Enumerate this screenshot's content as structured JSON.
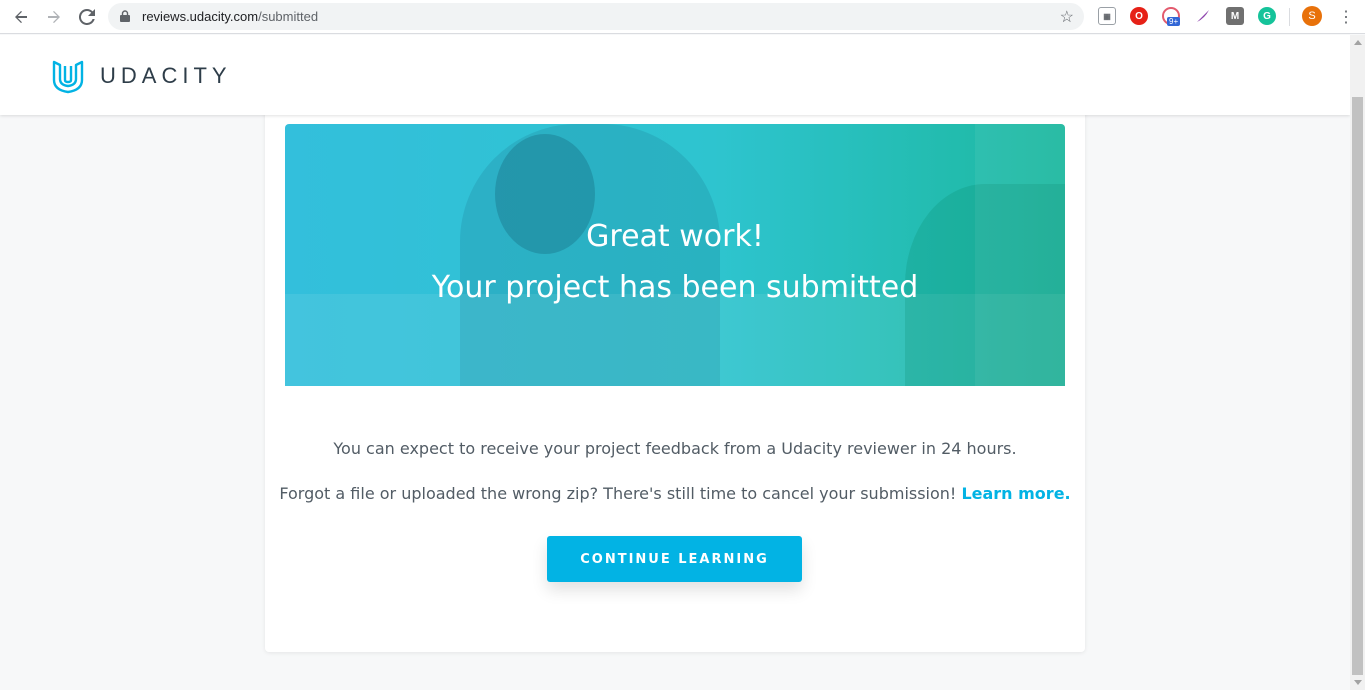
{
  "browser": {
    "url_host": "reviews.udacity.com",
    "url_path": "/submitted",
    "extension_badge": "9+",
    "profile_initial": "S",
    "icons": [
      "back-icon",
      "forward-icon",
      "reload-icon",
      "lock-icon",
      "star-icon",
      "kebab-menu-icon"
    ]
  },
  "header": {
    "logo_text": "UDACITY"
  },
  "hero": {
    "title": "Great work!",
    "subtitle": "Your project has been submitted"
  },
  "content": {
    "feedback_text": "You can expect to receive your project feedback from a Udacity reviewer in 24 hours.",
    "cancel_text": "Forgot a file or uploaded the wrong zip? There's still time to cancel your submission!",
    "learn_more_link": "Learn more.",
    "cta_label": "CONTINUE LEARNING"
  },
  "colors": {
    "brand": "#02b3e4",
    "text": "#525c65",
    "hero_start": "#33bfdc",
    "hero_end": "#1db89f"
  }
}
